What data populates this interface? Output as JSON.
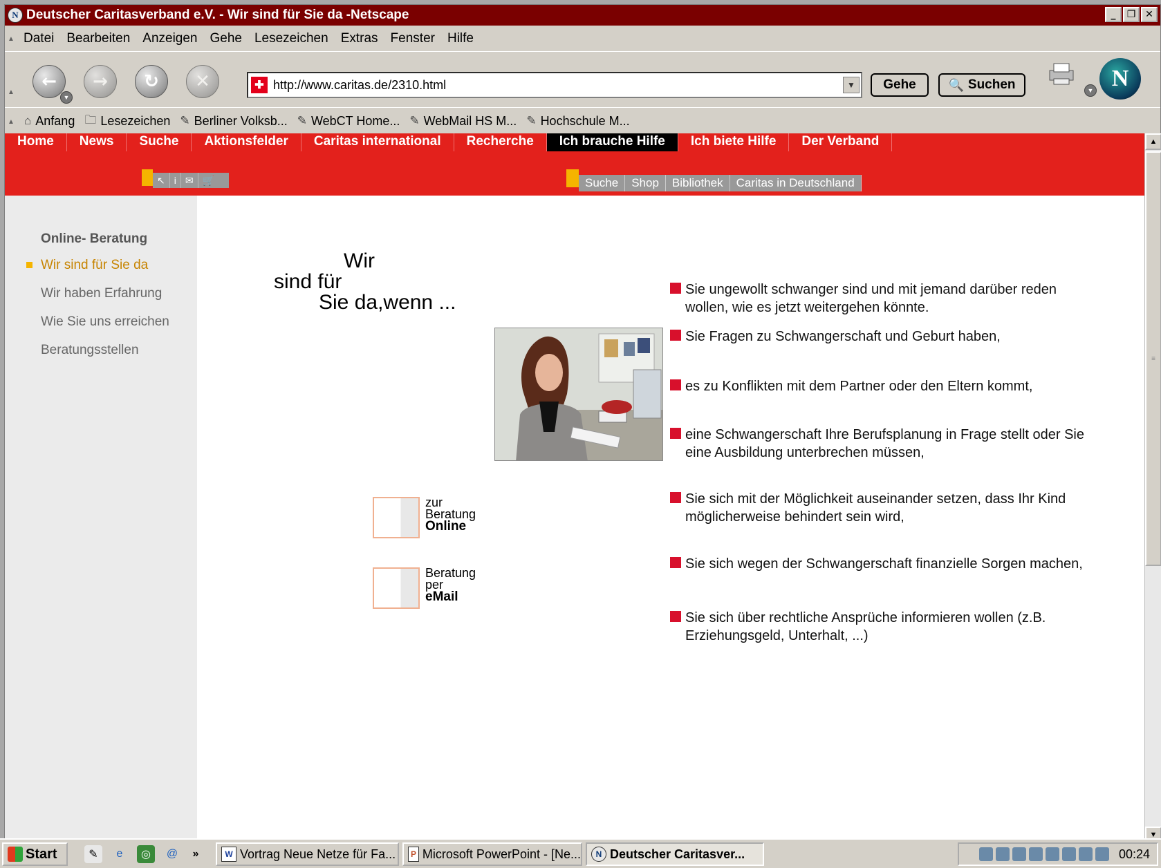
{
  "window": {
    "title": "Deutscher Caritasverband e.V. - Wir sind für Sie da -Netscape"
  },
  "menu": [
    "Datei",
    "Bearbeiten",
    "Anzeigen",
    "Gehe",
    "Lesezeichen",
    "Extras",
    "Fenster",
    "Hilfe"
  ],
  "toolbar": {
    "url": "http://www.caritas.de/2310.html",
    "go_label": "Gehe",
    "search_label": "Suchen"
  },
  "bookmarks": {
    "home": "Anfang",
    "items": [
      "Lesezeichen",
      "Berliner Volksb...",
      "WebCT Home...",
      "WebMail HS M...",
      "Hochschule M..."
    ]
  },
  "site": {
    "topnav": [
      "Home",
      "News",
      "Suche",
      "Aktionsfelder",
      "Caritas international",
      "Recherche",
      "Ich brauche Hilfe",
      "Ich biete Hilfe",
      "Der Verband"
    ],
    "active_topnav": "Ich brauche Hilfe",
    "tools": [
      "↖",
      "i",
      "✉",
      "🛒"
    ],
    "sublinks": [
      "Suche",
      "Shop",
      "Bibliothek",
      "Caritas in Deutschland"
    ],
    "sidebar": {
      "heading": "Online- Beratung",
      "items": [
        "Wir sind für Sie da",
        "Wir haben Erfahrung",
        "Wie Sie uns erreichen",
        "Beratungsstellen"
      ],
      "active_item": "Wir sind für Sie da"
    },
    "headline": {
      "line1": "Wir",
      "line2": "sind für",
      "line3": "Sie da,wenn ..."
    },
    "cta_online": {
      "line1": "zur",
      "line2": "Beratung",
      "line3": "Online"
    },
    "cta_email": {
      "line1": "Beratung",
      "line2": "per",
      "line3": "eMail"
    },
    "reasons": [
      "Sie ungewollt schwanger sind und mit jemand darüber reden wollen, wie es jetzt weitergehen könnte.",
      "Sie Fragen zu Schwangerschaft und Geburt haben,",
      "es zu Konflikten mit dem Partner oder den Eltern kommt,",
      "eine Schwangerschaft Ihre Berufsplanung in Frage stellt oder Sie eine Ausbildung unterbrechen müssen,",
      "Sie sich mit der Möglichkeit auseinander setzen, dass Ihr Kind möglicherweise behindert sein wird,",
      "Sie sich wegen der Schwangerschaft finanzielle Sorgen machen,",
      "Sie sich über rechtliche Ansprüche informieren wollen (z.B. Erziehungsgeld, Unterhalt, ...)"
    ],
    "colors": {
      "brand_red": "#e3211c",
      "bullet_red": "#d8102c",
      "accent_yellow": "#f5b400"
    }
  },
  "taskbar": {
    "start": "Start",
    "tasks": [
      "Vortrag Neue Netze für Fa...",
      "Microsoft PowerPoint - [Ne...",
      "Deutscher Caritasver..."
    ],
    "clock": "00:24"
  }
}
